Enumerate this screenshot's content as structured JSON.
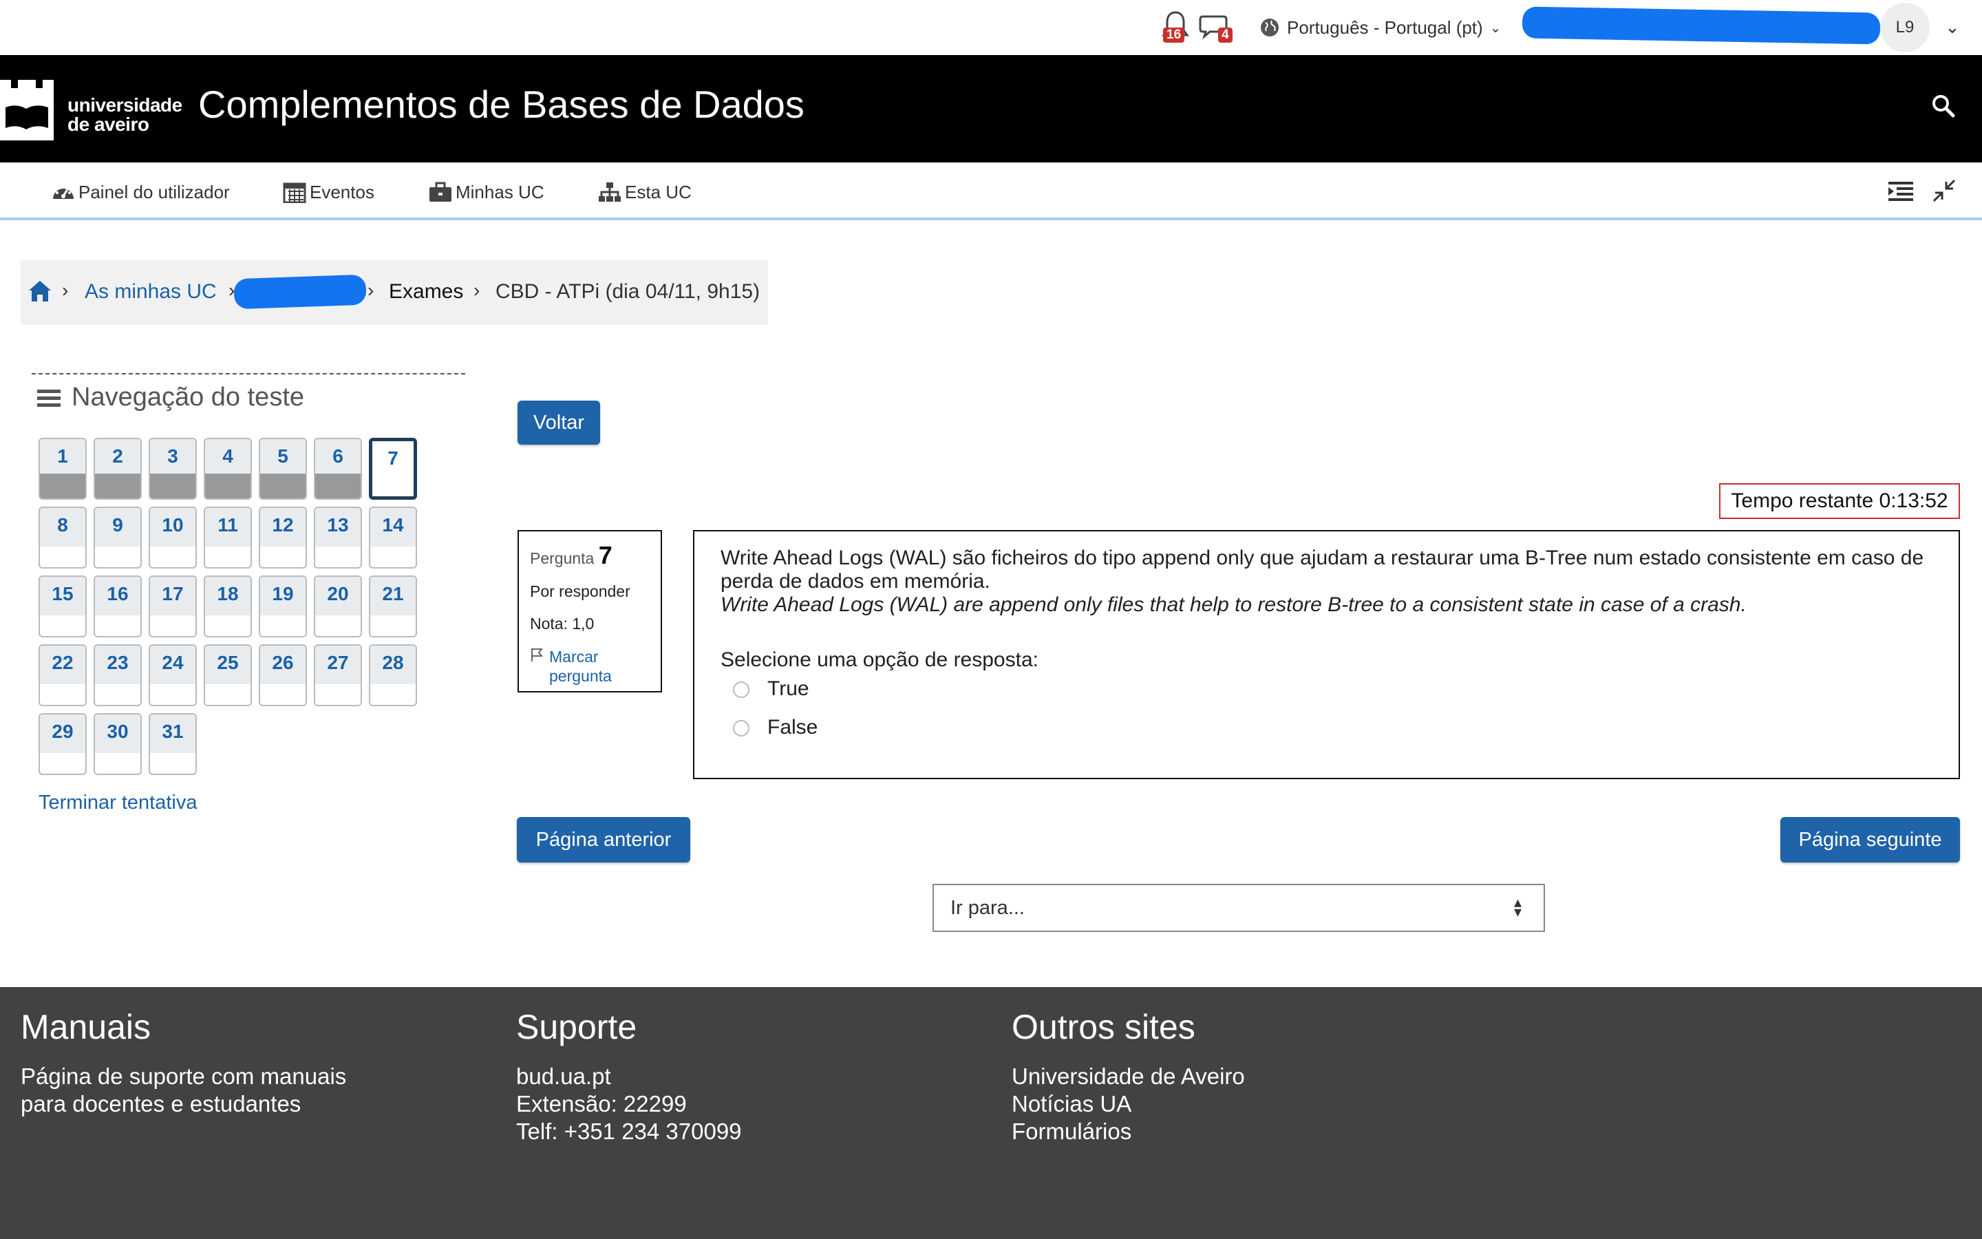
{
  "topbar": {
    "notifications_count": "16",
    "messages_count": "4",
    "language": "Português - Portugal (pt)",
    "user_initials": "L9"
  },
  "header": {
    "logo_line1": "universidade",
    "logo_line2": "de aveiro",
    "course_title": "Complementos de Bases de Dados"
  },
  "nav": {
    "items": [
      {
        "label": "Painel do utilizador",
        "icon": "dashboard-icon"
      },
      {
        "label": "Eventos",
        "icon": "calendar-icon"
      },
      {
        "label": "Minhas UC",
        "icon": "briefcase-icon"
      },
      {
        "label": "Esta UC",
        "icon": "sitemap-icon"
      }
    ]
  },
  "breadcrumb": {
    "items": [
      "As minhas UC",
      "Exames",
      "CBD - ATPi (dia 04/11, 9h15)"
    ]
  },
  "quiz_nav": {
    "title": "Navegação do teste",
    "questions": [
      "1",
      "2",
      "3",
      "4",
      "5",
      "6",
      "7",
      "8",
      "9",
      "10",
      "11",
      "12",
      "13",
      "14",
      "15",
      "16",
      "17",
      "18",
      "19",
      "20",
      "21",
      "22",
      "23",
      "24",
      "25",
      "26",
      "27",
      "28",
      "29",
      "30",
      "31"
    ],
    "answered": [
      "1",
      "2",
      "3",
      "4",
      "5",
      "6"
    ],
    "current": "7",
    "finish_label": "Terminar tentativa"
  },
  "back_button": "Voltar",
  "timer": "Tempo restante 0:13:52",
  "question": {
    "label": "Pergunta",
    "number": "7",
    "status": "Por responder",
    "grade": "Nota: 1,0",
    "flag_label": "Marcar pergunta",
    "text_pt": "Write Ahead Logs (WAL) são ficheiros do tipo append only que ajudam a restaurar uma B-Tree num estado consistente em caso de perda de dados em memória.",
    "text_en": "Write Ahead Logs (WAL) are append only files that help to restore B-tree to a consistent state in case of a crash.",
    "prompt": "Selecione uma opção de resposta:",
    "options": [
      "True",
      "False"
    ]
  },
  "pagination": {
    "prev": "Página anterior",
    "next": "Página seguinte",
    "goto_placeholder": "Ir para..."
  },
  "footer": {
    "manuals_title": "Manuais",
    "manuals_line1": "Página de suporte com manuais",
    "manuals_line2": "para docentes e estudantes",
    "support_title": "Suporte",
    "support_line1": "bud.ua.pt",
    "support_line2": "Extensão: 22299",
    "support_line3": "Telf: +351 234 370099",
    "sites_title": "Outros sites",
    "sites_link1": "Universidade de Aveiro",
    "sites_link2": "Notícias UA",
    "sites_link3": "Formulários"
  },
  "colors": {
    "primary": "#1f63a8",
    "link": "#1a61a8",
    "header_bg": "#000000",
    "footer_bg": "#424242",
    "timer_border": "#c9302c",
    "redaction": "#1374f0"
  }
}
